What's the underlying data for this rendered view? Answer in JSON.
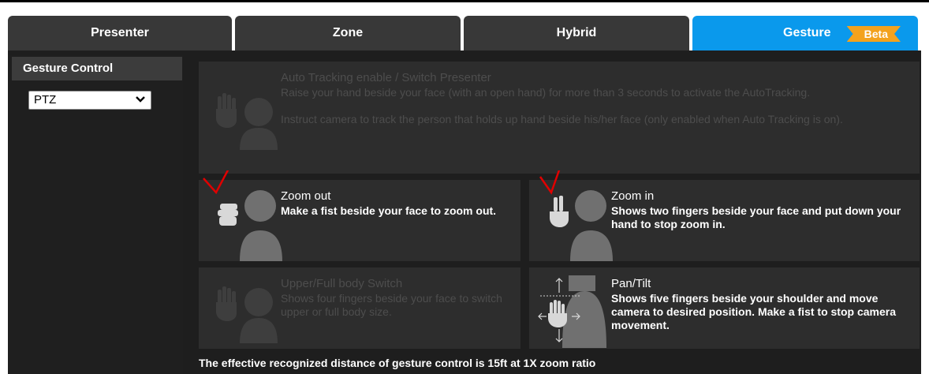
{
  "tabs": [
    {
      "label": "Presenter",
      "active": false
    },
    {
      "label": "Zone",
      "active": false
    },
    {
      "label": "Hybrid",
      "active": false
    },
    {
      "label": "Gesture",
      "active": true,
      "badge": "Beta"
    }
  ],
  "sidebar": {
    "title": "Gesture Control",
    "mode_select": {
      "value": "PTZ"
    }
  },
  "cards": {
    "auto_tracking": {
      "title": "Auto Tracking enable / Switch Presenter",
      "desc1": "Raise your hand beside your face (with an open hand) for more than 3 seconds to activate the AutoTracking.",
      "desc2": "Instruct camera to track the person that holds up hand beside his/her face (only enabled when Auto Tracking is on).",
      "enabled": false
    },
    "zoom_out": {
      "title": "Zoom out",
      "desc": "Make a fist beside your face to zoom out.",
      "enabled": true
    },
    "zoom_in": {
      "title": "Zoom in",
      "desc": "Shows two fingers beside your face and put down your hand to stop zoom in.",
      "enabled": true
    },
    "body_switch": {
      "title": "Upper/Full body Switch",
      "desc": "Shows four fingers beside your face to switch upper or full body size.",
      "enabled": false
    },
    "pan_tilt": {
      "title": "Pan/Tilt",
      "desc": "Shows five fingers beside your shoulder and move camera to desired position. Make a fist to stop camera movement.",
      "enabled": true
    }
  },
  "footer": "The effective recognized distance of gesture control is 15ft at 1X zoom ratio",
  "colors": {
    "tab_bg": "#383838",
    "tab_active": "#0a99ec",
    "badge": "#f3a21d",
    "card_bg": "#2d2d2d",
    "annotation_check": "#e00000"
  }
}
